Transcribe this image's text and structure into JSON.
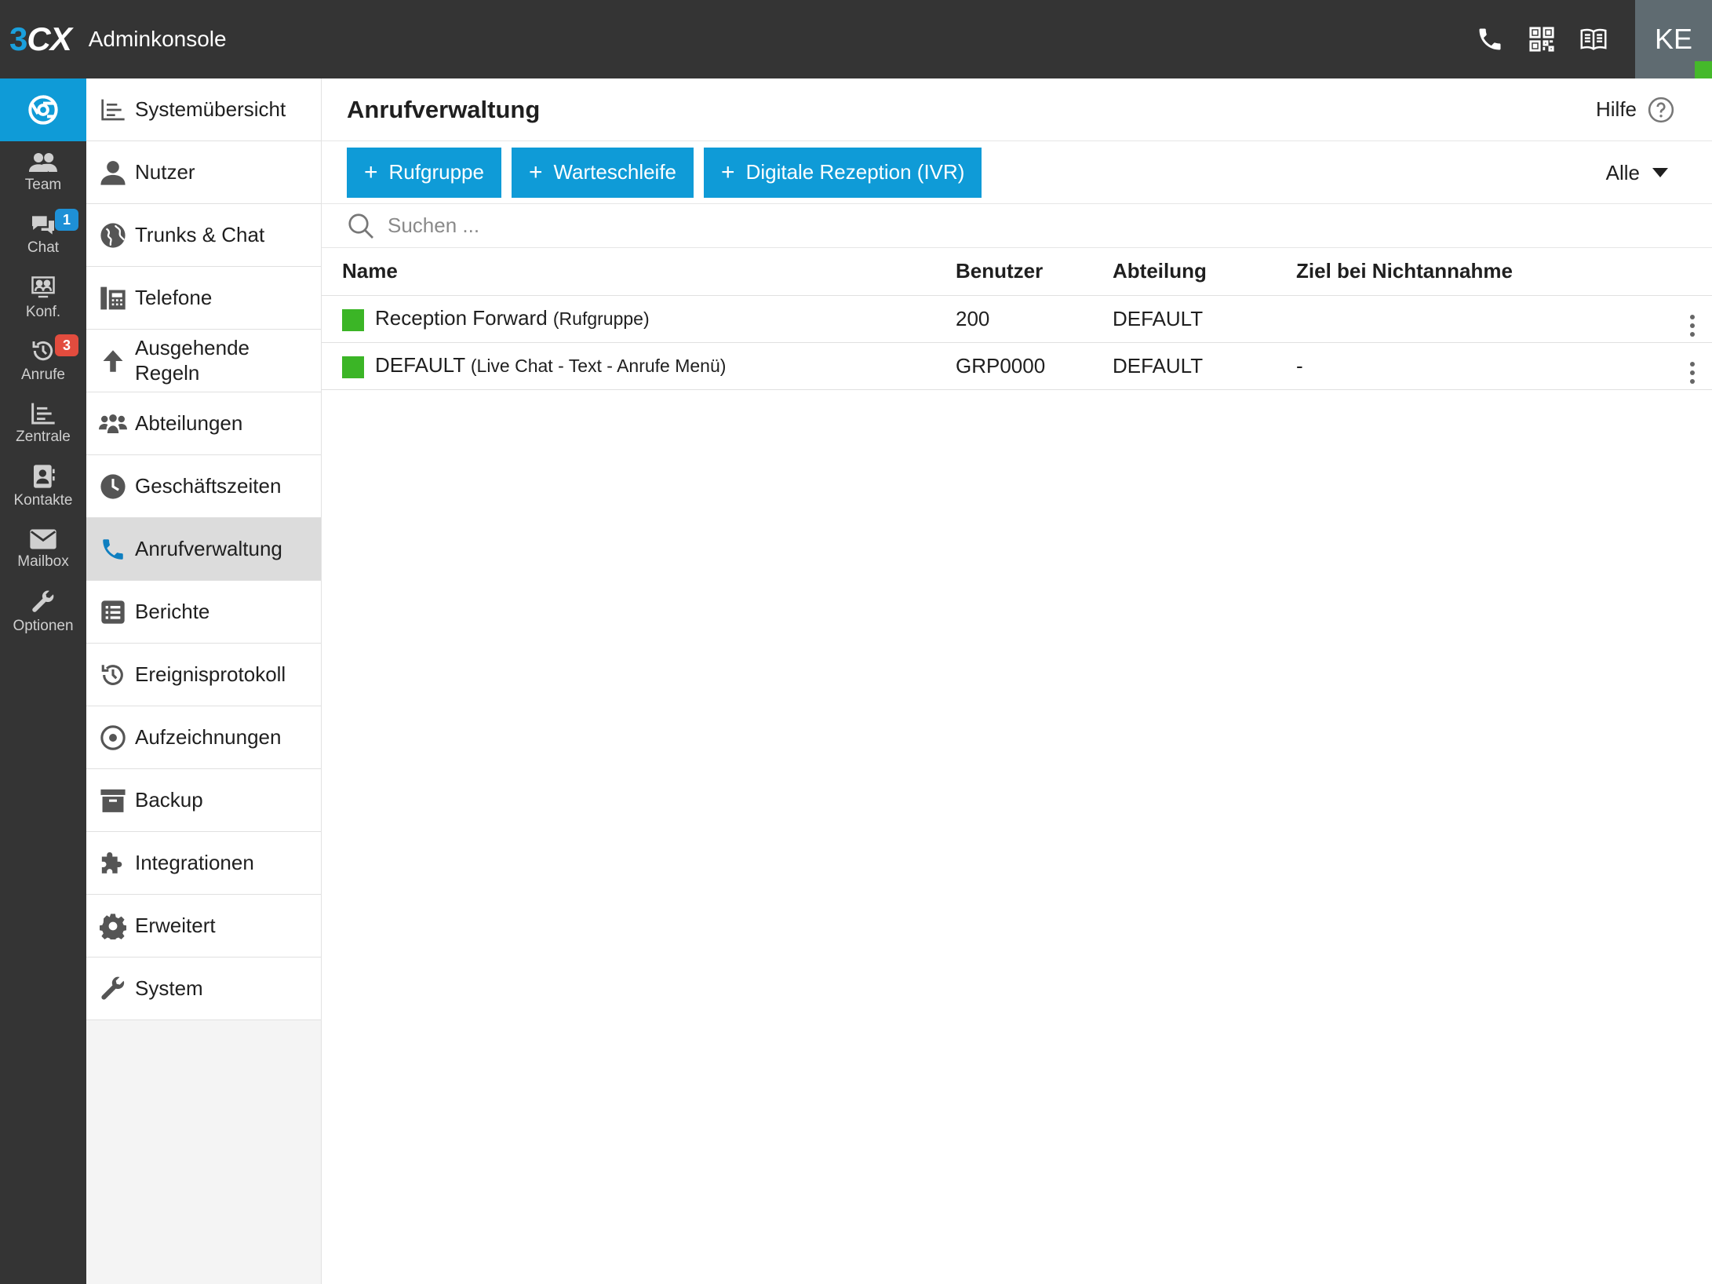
{
  "topbar": {
    "logo_num": "3",
    "logo_cx": "CX",
    "title": "Adminkonsole",
    "icons": [
      "phone-icon",
      "qr-code-icon",
      "manual-book-icon"
    ],
    "avatar_initials": "KE",
    "status_color": "#45b92a"
  },
  "rail": {
    "items": [
      {
        "label": "Team",
        "icon": "team-icon"
      },
      {
        "label": "Chat",
        "icon": "chat-icon",
        "badge": "1"
      },
      {
        "label": "Konf.",
        "icon": "conference-icon"
      },
      {
        "label": "Anrufe",
        "icon": "call-history-icon",
        "badge": "3"
      },
      {
        "label": "Zentrale",
        "icon": "switchboard-icon"
      },
      {
        "label": "Kontakte",
        "icon": "contacts-icon"
      },
      {
        "label": "Mailbox",
        "icon": "mailbox-icon"
      },
      {
        "label": "Optionen",
        "icon": "options-wrench-icon"
      }
    ]
  },
  "sidenav": {
    "items": [
      {
        "label": "Systemübersicht",
        "icon": "dashboard-icon"
      },
      {
        "label": "Nutzer",
        "icon": "user-icon"
      },
      {
        "label": "Trunks & Chat",
        "icon": "globe-icon"
      },
      {
        "label": "Telefone",
        "icon": "desk-phone-icon"
      },
      {
        "label": "Ausgehende Regeln",
        "icon": "arrow-up-icon"
      },
      {
        "label": "Abteilungen",
        "icon": "group-icon"
      },
      {
        "label": "Geschäftszeiten",
        "icon": "clock-icon"
      },
      {
        "label": "Anrufverwaltung",
        "icon": "phone-handset-icon",
        "active": true
      },
      {
        "label": "Berichte",
        "icon": "report-list-icon"
      },
      {
        "label": "Ereignisprotokoll",
        "icon": "history-icon"
      },
      {
        "label": "Aufzeichnungen",
        "icon": "record-icon"
      },
      {
        "label": "Backup",
        "icon": "archive-box-icon"
      },
      {
        "label": "Integrationen",
        "icon": "puzzle-icon"
      },
      {
        "label": "Erweitert",
        "icon": "gear-icon"
      },
      {
        "label": "System",
        "icon": "wrench-icon"
      }
    ]
  },
  "main": {
    "title": "Anrufverwaltung",
    "help_label": "Hilfe",
    "buttons": [
      "Rufgruppe",
      "Warteschleife",
      "Digitale Rezeption (IVR)"
    ],
    "button_plus": "+",
    "filter_label": "Alle",
    "search_placeholder": "Suchen ...",
    "columns": [
      "Name",
      "Benutzer",
      "Abteilung",
      "Ziel bei Nichtannahme"
    ],
    "rows": [
      {
        "name": "Reception Forward",
        "type": "(Rufgruppe)",
        "user": "200",
        "dept": "DEFAULT",
        "target": "",
        "status_color": "#3bb526"
      },
      {
        "name": "DEFAULT",
        "type": "(Live Chat - Text - Anrufe Menü)",
        "user": "GRP0000",
        "dept": "DEFAULT",
        "target": "-",
        "status_color": "#3bb526"
      }
    ]
  },
  "colors": {
    "accent": "#0f9bd7",
    "topbar": "#343434",
    "badge_blue": "#1e90d6",
    "badge_red": "#e24c3e",
    "status_green": "#3bb526"
  }
}
